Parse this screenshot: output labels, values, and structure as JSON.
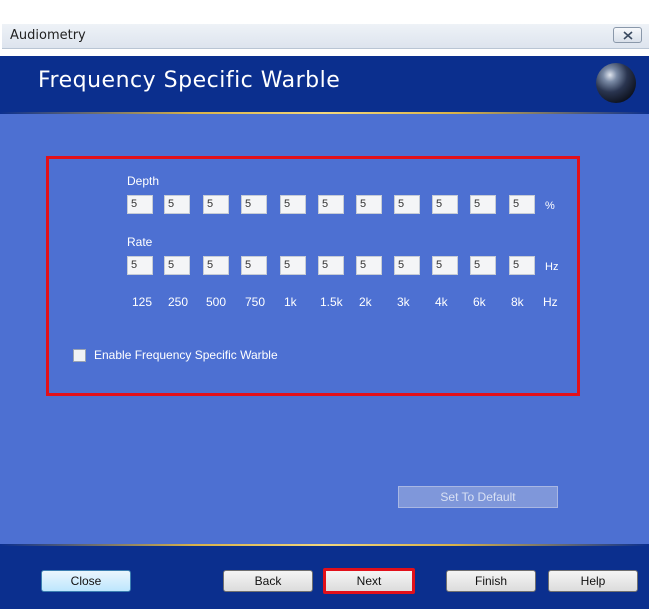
{
  "window": {
    "title": "Audiometry"
  },
  "header": {
    "heading": "Frequency Specific Warble"
  },
  "warble": {
    "depth_label": "Depth",
    "depth_values": [
      "5",
      "5",
      "5",
      "5",
      "5",
      "5",
      "5",
      "5",
      "5",
      "5",
      "5"
    ],
    "depth_unit": "%",
    "rate_label": "Rate",
    "rate_values": [
      "5",
      "5",
      "5",
      "5",
      "5",
      "5",
      "5",
      "5",
      "5",
      "5",
      "5"
    ],
    "rate_unit": "Hz",
    "frequencies": [
      "125",
      "250",
      "500",
      "750",
      "1k",
      "1.5k",
      "2k",
      "3k",
      "4k",
      "6k",
      "8k"
    ],
    "frequency_unit": "Hz",
    "enable_label": "Enable Frequency Specific Warble",
    "enable_checked": false
  },
  "buttons": {
    "set_default": "Set To Default",
    "close": "Close",
    "back": "Back",
    "next": "Next",
    "finish": "Finish",
    "help": "Help"
  },
  "colors": {
    "header_bg": "#0b2f8e",
    "content_bg": "#4d70d2",
    "highlight": "#e2101a"
  }
}
